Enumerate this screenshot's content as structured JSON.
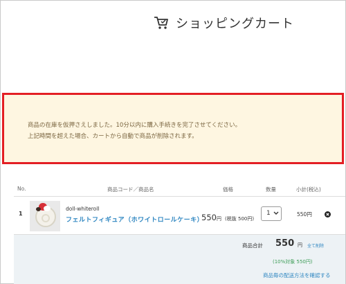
{
  "header": {
    "title": "ショッピングカート",
    "icon": "shopping-cart-icon"
  },
  "notice": {
    "line1": "商品の在庫を仮押さえしました。10分以内に購入手続きを完了させてください。",
    "line2": "上記時間を超えた場合、カートから自動で商品が削除されます。"
  },
  "table": {
    "headers": {
      "no": "No.",
      "code_name": "商品コード／商品名",
      "price": "価格",
      "qty": "数量",
      "subtotal": "小計(税込)"
    },
    "rows": [
      {
        "no": "1",
        "code": "doll-whiteroll",
        "name": "フェルトフィギュア（ホワイトロールケーキ）",
        "price": "550",
        "price_unit": "円",
        "price_tax": "(税抜 500円)",
        "qty": "1",
        "subtotal": "550円"
      }
    ]
  },
  "summary": {
    "total_label": "商品合計",
    "total_value": "550",
    "total_unit": "円",
    "clear_all": "全て削除",
    "tax_target": "(10%対象 550円)",
    "shipping_link": "商品毎の配送方法を確認する"
  },
  "colors": {
    "notice_border": "#e31e24",
    "notice_bg": "#fef6e1",
    "link": "#2e86c1",
    "tax_text": "#3c9c56"
  }
}
